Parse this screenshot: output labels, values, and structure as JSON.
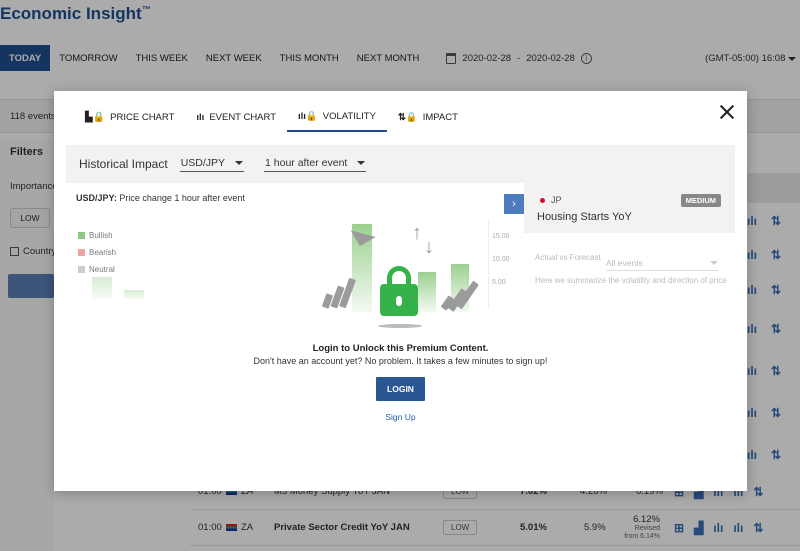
{
  "app": {
    "title": "Economic Insight",
    "tm": "™"
  },
  "date_tabs": [
    "TODAY",
    "TOMORROW",
    "THIS WEEK",
    "NEXT WEEK",
    "THIS MONTH",
    "NEXT MONTH"
  ],
  "date_range": {
    "from": "2020-02-28",
    "sep": "-",
    "to": "2020-02-28"
  },
  "timezone": "(GMT-05:00) 16:08",
  "events_count": "118 events",
  "sidebar": {
    "filters": "Filters",
    "importance": "Importance",
    "low": "LOW",
    "country": "Country"
  },
  "rows": [
    {
      "time": "01:00",
      "country": "ZA",
      "event": "M3 Money Supply YoY JAN",
      "importance": "LOW",
      "actual": "7.02%",
      "forecast": "4.26%",
      "previous": "6.19%",
      "revised": ""
    },
    {
      "time": "01:00",
      "country": "ZA",
      "event": "Private Sector Credit YoY JAN",
      "importance": "LOW",
      "actual": "5.01%",
      "forecast": "5.9%",
      "previous": "6.12%",
      "revised": "Revised from 6.14%"
    }
  ],
  "modal": {
    "tabs": [
      {
        "label": "PRICE CHART",
        "icon": "locked-chart-icon"
      },
      {
        "label": "EVENT CHART",
        "icon": "bar-chart-icon"
      },
      {
        "label": "VOLATILITY",
        "icon": "locked-volatility-icon"
      },
      {
        "label": "IMPACT",
        "icon": "locked-impact-icon"
      }
    ],
    "active_tab": "VOLATILITY",
    "impact_title": "Historical Impact",
    "pair": "USD/JPY",
    "window": "1 hour after event",
    "chart_pair": "USD/JPY:",
    "chart_desc": " Price change 1 hour after event",
    "legend": [
      "Bullish",
      "Bearish",
      "Neutral"
    ],
    "legend_colors": [
      "#8cc983",
      "#e8a3a3",
      "#cccccc"
    ],
    "ticks": [
      "15.00",
      "10.00",
      "5.00"
    ],
    "event": {
      "country": "JP",
      "name": "Housing Starts YoY",
      "importance": "MEDIUM"
    },
    "actual_label": "Actual vs Forecast",
    "all_events": "All events",
    "summary_text": "Here we summarize the volatility and direction of price",
    "lock_title": "Login to Unlock this Premium Content.",
    "lock_sub": "Don't have an account yet? No problem. It takes a few minutes to sign up!",
    "login": "LOGIN",
    "signup": "Sign Up"
  }
}
